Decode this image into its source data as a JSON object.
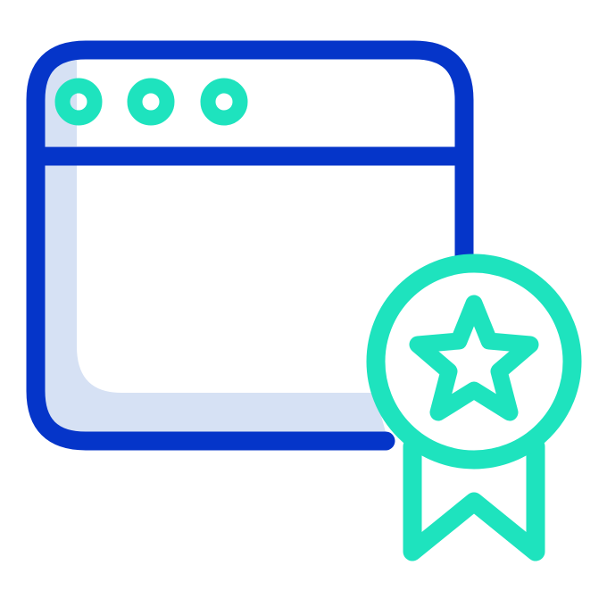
{
  "icon": {
    "name": "browser-window-award-icon",
    "parts": [
      "browser-window-icon",
      "window-dot-icon",
      "award-medal-icon",
      "star-icon",
      "ribbon-icon"
    ]
  },
  "colors": {
    "window_outline": "#0535C9",
    "window_shadow": "#D6E1F4",
    "accent": "#1EE3BE",
    "background": "#FFFFFF"
  }
}
